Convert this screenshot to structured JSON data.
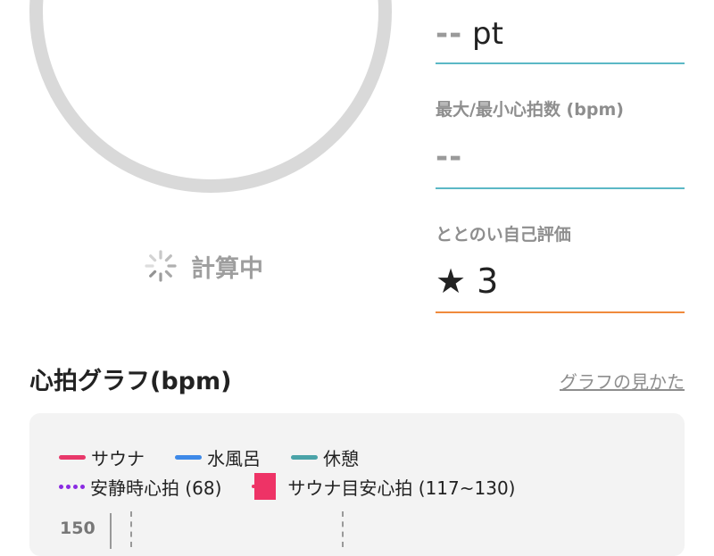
{
  "gauge": {
    "value": "-- --",
    "status": "計算中"
  },
  "score": {
    "value_placeholder": "--",
    "unit": "pt"
  },
  "heart_rate_max_min": {
    "label": "最大/最小心拍数 (bpm)",
    "value": "--"
  },
  "self_rating": {
    "label": "ととのい自己評価",
    "star_icon": "★",
    "value": "3"
  },
  "heart_graph": {
    "title": "心拍グラフ(bpm)",
    "guide_link": "グラフの見かた",
    "legend": [
      {
        "label": "サウナ",
        "color": "#e8386a",
        "style": "line"
      },
      {
        "label": "水風呂",
        "color": "#3e89e8",
        "style": "line"
      },
      {
        "label": "休憩",
        "color": "#4aa3a8",
        "style": "line"
      },
      {
        "label": "安静時心拍 (68)",
        "color": "#8a2be2",
        "style": "dots"
      },
      {
        "label": "サウナ目安心拍 (117~130)",
        "color": "#ee3366",
        "style": "box"
      }
    ],
    "y_tick_top": "150"
  },
  "colors": {
    "teal_underline": "#5bb8c6",
    "orange_underline": "#f08a3c",
    "ring": "#d9d9d9"
  }
}
